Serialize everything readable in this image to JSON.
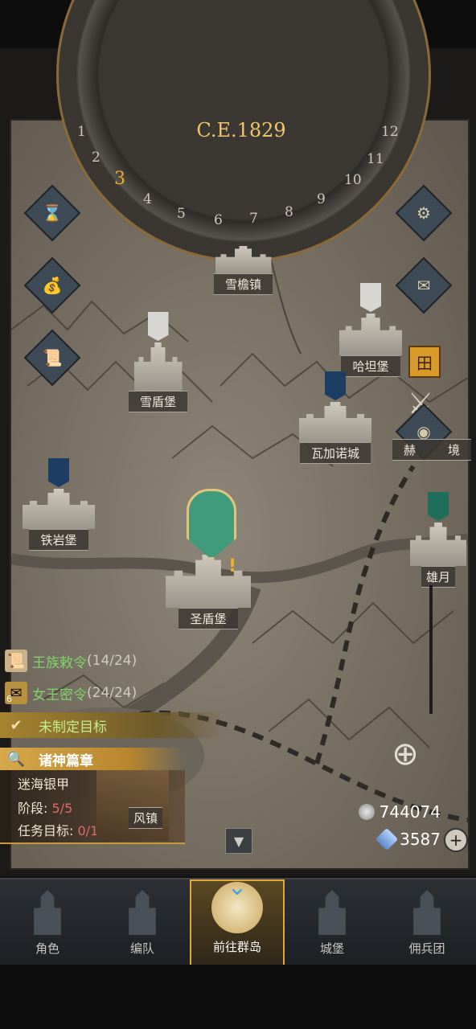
{
  "top": {
    "year": "C.E.1829",
    "dial_numbers": [
      "1",
      "2",
      "3",
      "4",
      "5",
      "6",
      "7",
      "8",
      "9",
      "10",
      "11",
      "12"
    ],
    "active_month": "3"
  },
  "places": {
    "xueqiao": "雪檐镇",
    "hatan": "哈坦堡",
    "xuedun": "雪盾堡",
    "waga": "瓦加诺城",
    "hejing": "赫",
    "hejing_tail": "境",
    "tieyan": "铁岩堡",
    "shengdun": "圣盾堡",
    "xiongyue": "雄月",
    "feng": "风镇"
  },
  "quests": {
    "royal": {
      "label": "王族敕令",
      "count": "(14/24)",
      "badge": ""
    },
    "queen": {
      "label": "女王密令",
      "count": "(24/24)",
      "badge": "6"
    },
    "goal": "未制定目标",
    "chapter": "诸神篇章",
    "chapter_item": "迷海银甲",
    "stage_label": "阶段:",
    "stage_value": "5/5",
    "target_label": "任务目标:",
    "target_value": "0/1"
  },
  "resources": {
    "silver": "744074",
    "crystal": "3587"
  },
  "nav": [
    {
      "label": "角色"
    },
    {
      "label": "编队"
    },
    {
      "label": "前往群岛"
    },
    {
      "label": "城堡"
    },
    {
      "label": "佣兵团"
    }
  ],
  "colors": {
    "accent_gold": "#e0a83a",
    "quest_green": "#7fd36a",
    "year_gold": "#f2c46a"
  },
  "icons": [
    "hourglass-icon",
    "money-bag-icon",
    "scroll-icon",
    "gear-icon",
    "mail-icon",
    "castle-grid-icon",
    "crossed-swords-icon",
    "coin-icon",
    "locate-icon",
    "plus-icon",
    "collapse-arrow-icon",
    "helmet-marker-icon"
  ]
}
